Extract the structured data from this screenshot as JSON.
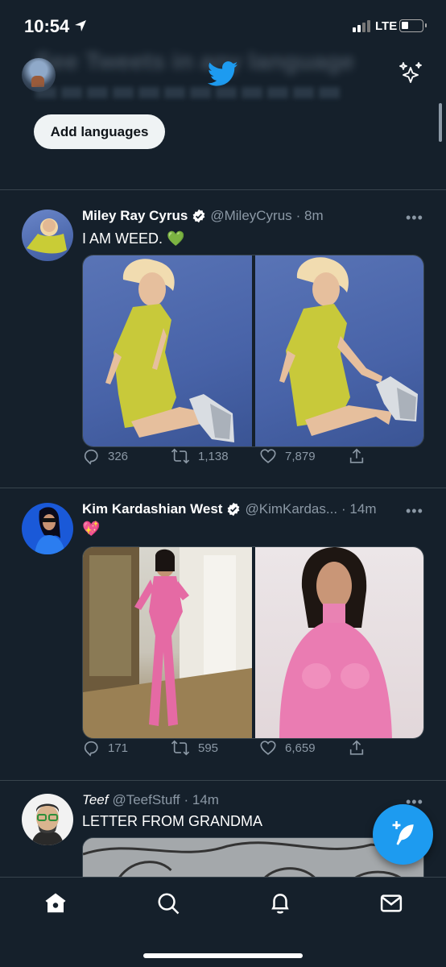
{
  "status_bar": {
    "time": "10:54",
    "network": "LTE"
  },
  "header": {
    "banner_text": "See Tweets in any language",
    "add_languages_label": "Add languages"
  },
  "tweets": [
    {
      "name": "Miley Ray Cyrus",
      "handle": "@MileyCyrus",
      "time": "· 8m",
      "text": "I AM WEED. 💚",
      "replies": "326",
      "retweets": "1,138",
      "likes": "7,879"
    },
    {
      "name": "Kim Kardashian West",
      "handle": "@KimKardas...",
      "time": "· 14m",
      "text": "💖",
      "replies": "171",
      "retweets": "595",
      "likes": "6,659"
    },
    {
      "name": "Teef",
      "handle": "@TeefStuff",
      "time": "· 14m",
      "text": "LETTER FROM GRANDMA"
    }
  ],
  "more_label": "•••",
  "nav": [
    "home-icon",
    "search-icon",
    "bell-icon",
    "mail-icon"
  ],
  "colors": {
    "background": "#15202b",
    "accent": "#1d9bf0",
    "secondary_text": "#8b98a5"
  }
}
